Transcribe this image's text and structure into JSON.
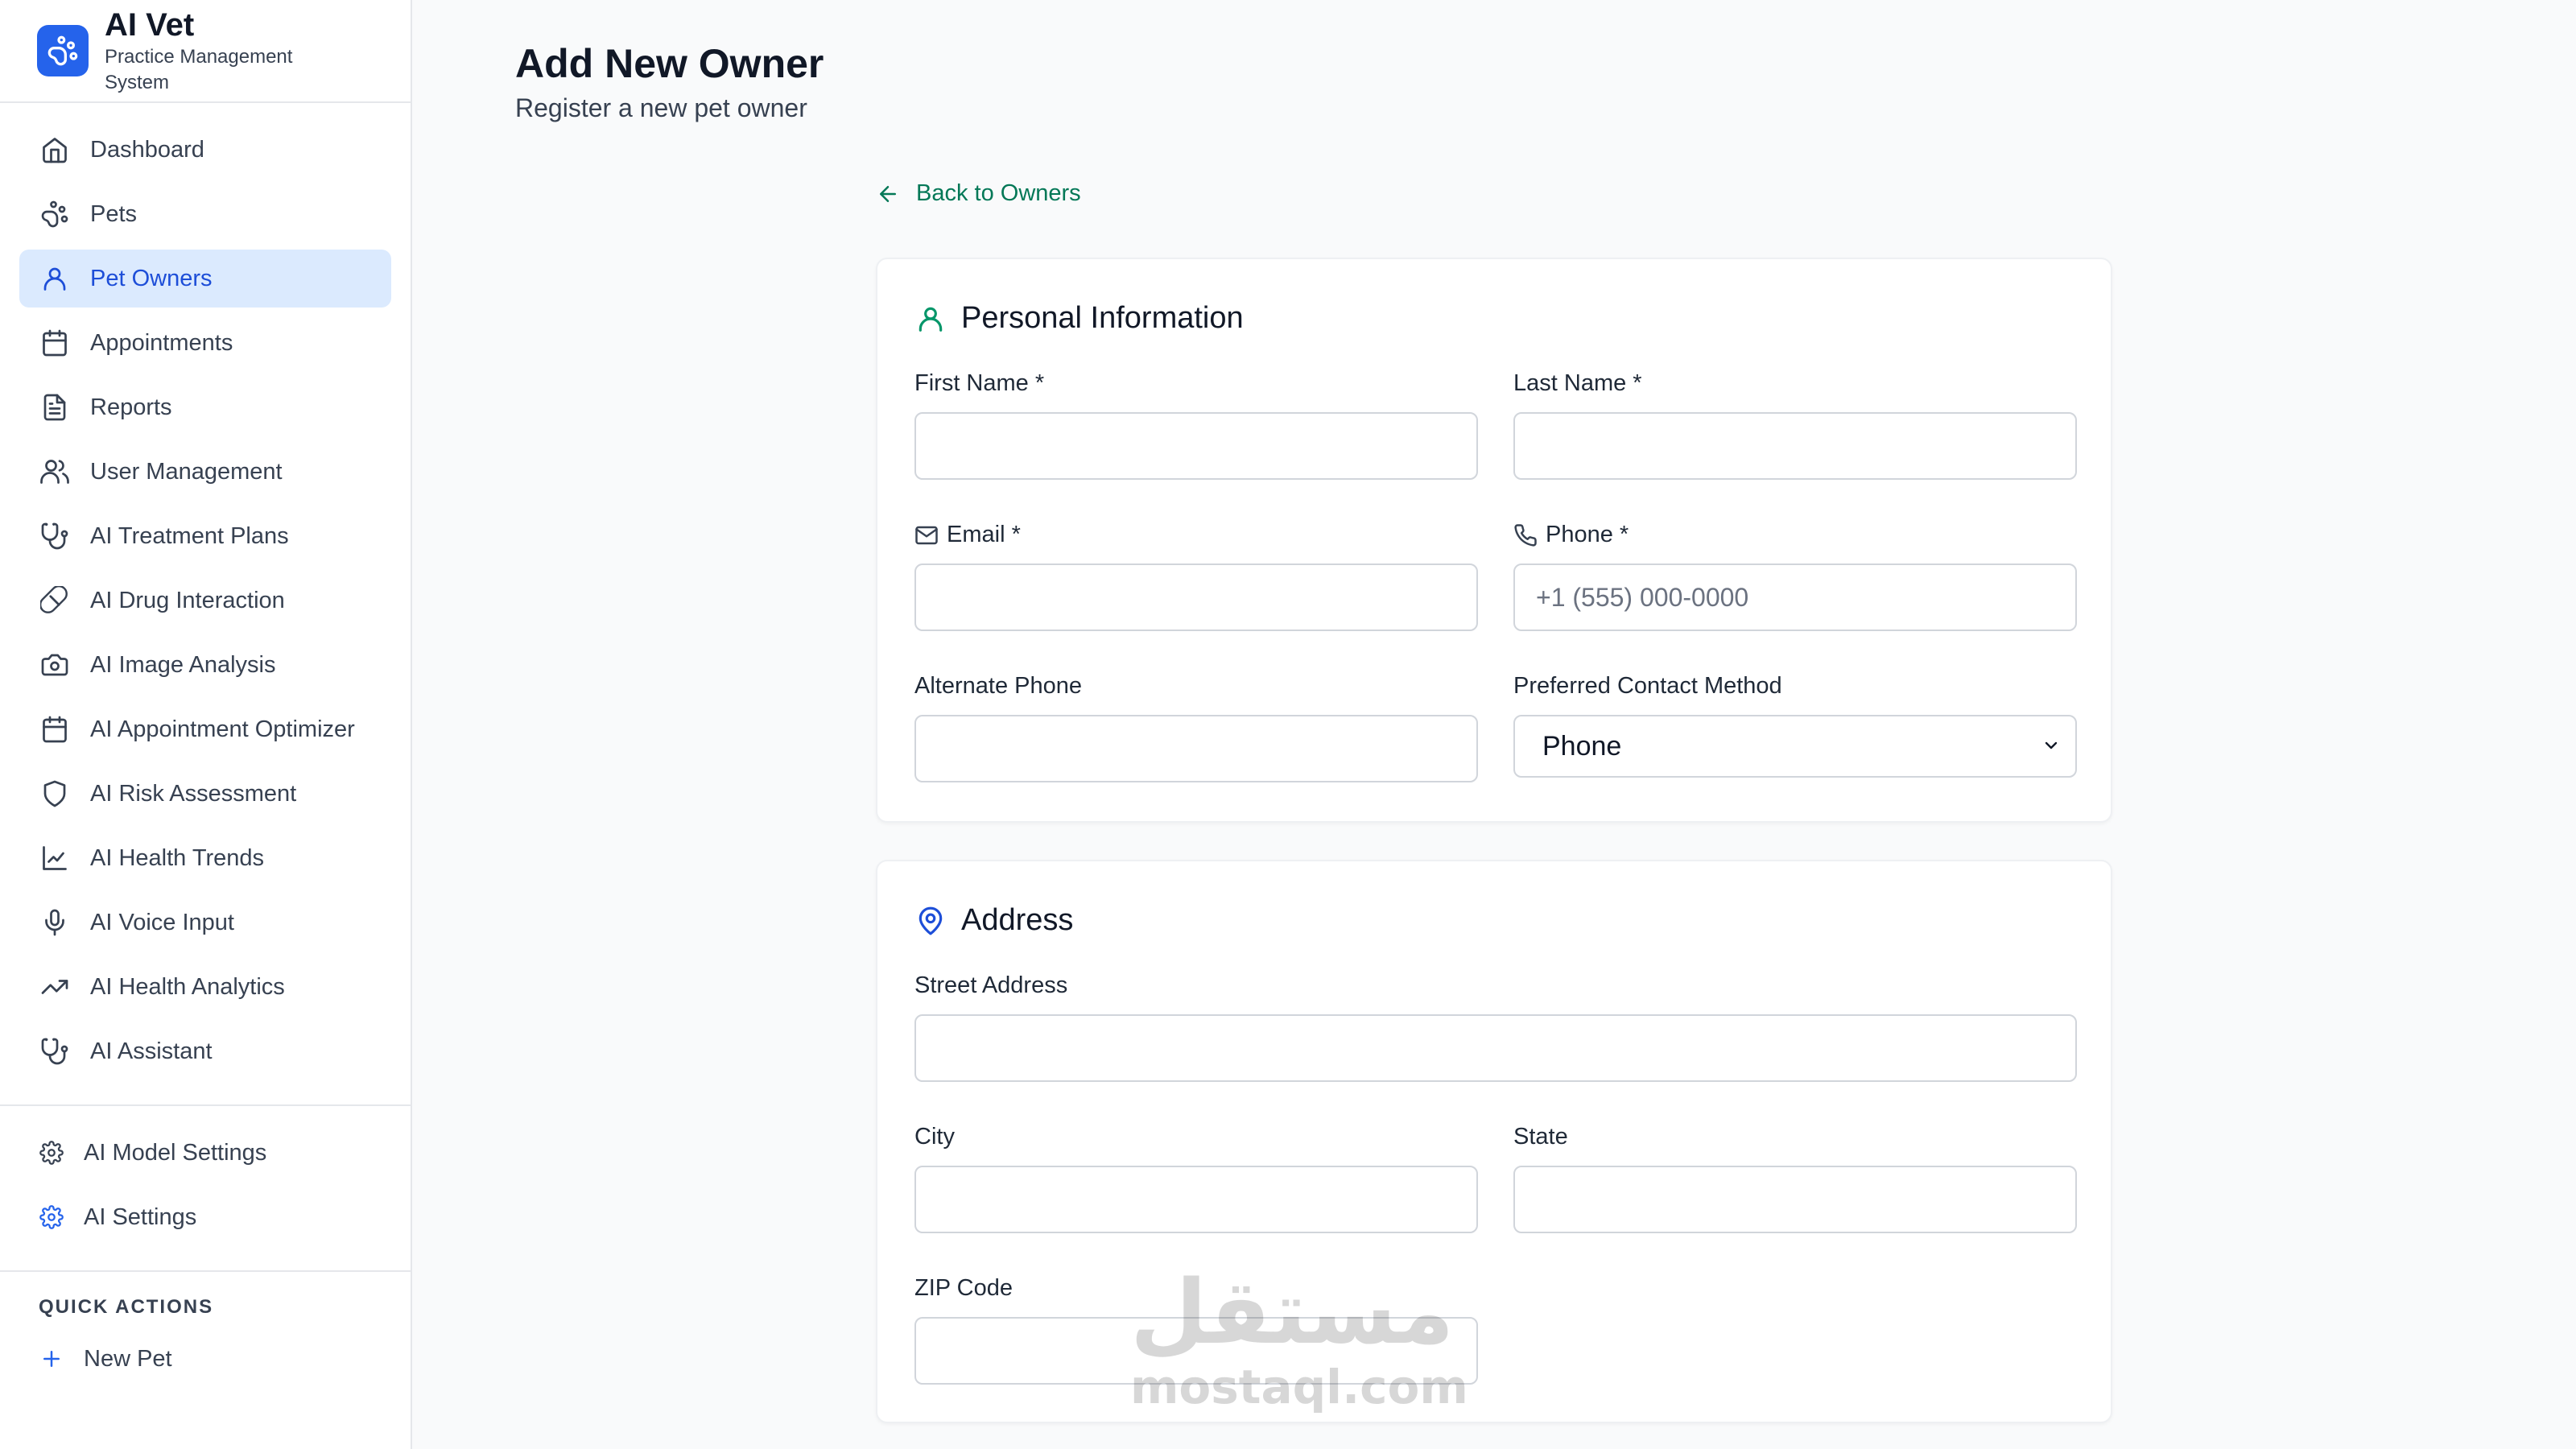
{
  "brand": {
    "title": "AI Vet",
    "subtitle": "Practice Management System"
  },
  "nav": [
    {
      "label": "Dashboard",
      "icon": "home-icon",
      "active": false
    },
    {
      "label": "Pets",
      "icon": "paw-icon",
      "active": false
    },
    {
      "label": "Pet Owners",
      "icon": "user-icon",
      "active": true
    },
    {
      "label": "Appointments",
      "icon": "calendar-icon",
      "active": false
    },
    {
      "label": "Reports",
      "icon": "file-text-icon",
      "active": false
    },
    {
      "label": "User Management",
      "icon": "users-icon",
      "active": false
    },
    {
      "label": "AI Treatment Plans",
      "icon": "stethoscope-icon",
      "active": false
    },
    {
      "label": "AI Drug Interaction",
      "icon": "pill-icon",
      "active": false
    },
    {
      "label": "AI Image Analysis",
      "icon": "camera-icon",
      "active": false
    },
    {
      "label": "AI Appointment Optimizer",
      "icon": "calendar-icon",
      "active": false
    },
    {
      "label": "AI Risk Assessment",
      "icon": "shield-icon",
      "active": false
    },
    {
      "label": "AI Health Trends",
      "icon": "line-chart-icon",
      "active": false
    },
    {
      "label": "AI Voice Input",
      "icon": "microphone-icon",
      "active": false
    },
    {
      "label": "AI Health Analytics",
      "icon": "trending-up-icon",
      "active": false
    },
    {
      "label": "AI Assistant",
      "icon": "stethoscope-icon",
      "active": false
    }
  ],
  "settings_nav": [
    {
      "label": "AI Model Settings",
      "icon": "gear-icon"
    },
    {
      "label": "AI Settings",
      "icon": "gear-icon"
    }
  ],
  "quick_actions": {
    "heading": "QUICK ACTIONS",
    "items": [
      {
        "label": "New Pet",
        "icon": "plus-icon"
      }
    ]
  },
  "page": {
    "title": "Add New Owner",
    "subtitle": "Register a new pet owner",
    "back_label": "Back to Owners"
  },
  "personal": {
    "heading": "Personal Information",
    "first_name_label": "First Name *",
    "last_name_label": "Last Name *",
    "email_label": "Email *",
    "phone_label": "Phone *",
    "phone_placeholder": "+1 (555) 000-0000",
    "alt_phone_label": "Alternate Phone",
    "contact_method_label": "Preferred Contact Method",
    "contact_method_value": "Phone"
  },
  "address": {
    "heading": "Address",
    "street_label": "Street Address",
    "city_label": "City",
    "state_label": "State",
    "zip_label": "ZIP Code"
  },
  "watermark": {
    "arabic": "مستقل",
    "latin": "mostaql.com"
  },
  "colors": {
    "accent_blue": "#2563eb",
    "active_bg": "#dbeafe",
    "active_text": "#1d4ed8",
    "link_green": "#047857",
    "icon_green": "#059669"
  }
}
